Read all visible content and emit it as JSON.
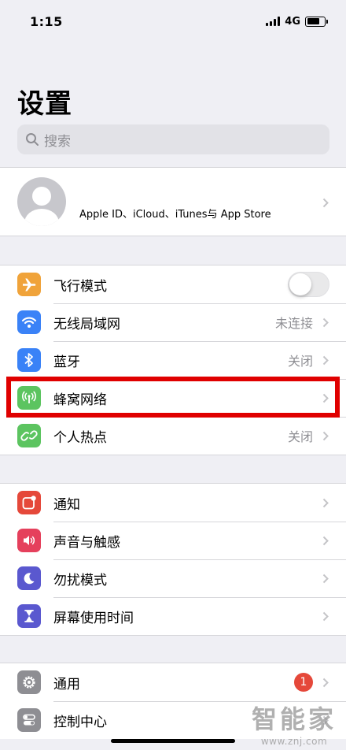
{
  "status_bar": {
    "time": "1:15",
    "network": "4G"
  },
  "header": {
    "title": "设置"
  },
  "search": {
    "placeholder": "搜索"
  },
  "profile": {
    "label": "Apple ID、iCloud、iTunes与 App Store"
  },
  "group1": [
    {
      "label": "飞行模式",
      "icon": "airplane-icon",
      "color": "#f0a33a",
      "control": "toggle",
      "toggle_on": false
    },
    {
      "label": "无线局域网",
      "icon": "wifi-icon",
      "color": "#3a82f7",
      "value": "未连接"
    },
    {
      "label": "蓝牙",
      "icon": "bluetooth-icon",
      "color": "#3a82f7",
      "value": "关闭"
    },
    {
      "label": "蜂窝网络",
      "icon": "cellular-icon",
      "color": "#5cc460"
    },
    {
      "label": "个人热点",
      "icon": "hotspot-icon",
      "color": "#5cc460",
      "value": "关闭"
    }
  ],
  "group2": [
    {
      "label": "通知",
      "icon": "notifications-icon",
      "color": "#e5483a"
    },
    {
      "label": "声音与触感",
      "icon": "sound-icon",
      "color": "#e5405c"
    },
    {
      "label": "勿扰模式",
      "icon": "moon-icon",
      "color": "#5a58cf"
    },
    {
      "label": "屏幕使用时间",
      "icon": "hourglass-icon",
      "color": "#5a58cf"
    }
  ],
  "group3": [
    {
      "label": "通用",
      "icon": "gear-icon",
      "color": "#8e8e93",
      "badge": "1"
    },
    {
      "label": "控制中心",
      "icon": "control-center-icon",
      "color": "#8e8e93"
    }
  ],
  "watermark": {
    "title": "智能家",
    "url": "www.znj.com"
  }
}
